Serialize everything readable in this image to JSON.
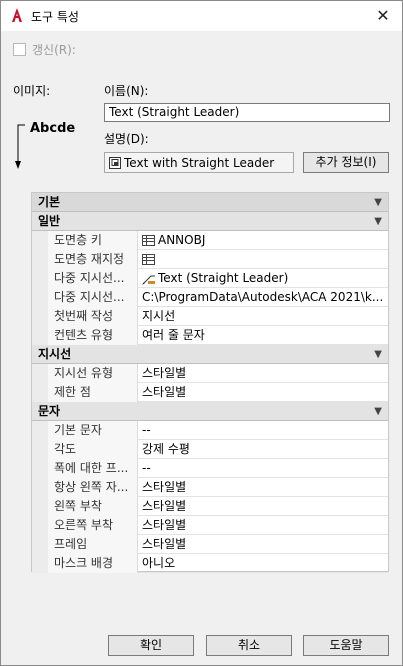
{
  "window": {
    "title": "도구 특성",
    "close_icon": "close-icon",
    "app_icon": "autocad-a-icon",
    "accent": "#c8102e"
  },
  "refresh": {
    "label": "갱신(R):",
    "checked": false
  },
  "image": {
    "label": "이미지:",
    "preview_text": "Abcde"
  },
  "name": {
    "label": "이름(N):",
    "value": "Text (Straight Leader)"
  },
  "description": {
    "label": "설명(D):",
    "value": "Text with Straight Leader"
  },
  "more_info_button": "추가 정보(I)",
  "grid": {
    "top_category": "기본",
    "sections": [
      {
        "title": "일반",
        "rows": [
          {
            "key": "도면층 키",
            "value": "ANNOBJ",
            "icon": "table-icon"
          },
          {
            "key": "도면층 재지정",
            "value": "",
            "icon": "table-icon"
          },
          {
            "key": "다중 지시선...",
            "value": "Text (Straight Leader)",
            "icon": "leader-icon"
          },
          {
            "key": "다중 지시선...",
            "value": "C:\\ProgramData\\Autodesk\\ACA  2021\\k..."
          },
          {
            "key": "첫번째 작성",
            "value": "지시선"
          },
          {
            "key": "컨텐츠 유형",
            "value": "여러 줄 문자"
          }
        ]
      },
      {
        "title": "지시선",
        "rows": [
          {
            "key": "지시선 유형",
            "value": "스타일별"
          },
          {
            "key": "제한 점",
            "value": "스타일별"
          }
        ]
      },
      {
        "title": "문자",
        "rows": [
          {
            "key": "기본 문자",
            "value": "--"
          },
          {
            "key": "각도",
            "value": "강제 수평"
          },
          {
            "key": "폭에 대한 프...",
            "value": "--"
          },
          {
            "key": "항상 왼쪽 자...",
            "value": "스타일별"
          },
          {
            "key": "왼쪽 부착",
            "value": "스타일별"
          },
          {
            "key": "오른쪽 부착",
            "value": "스타일별"
          },
          {
            "key": "프레임",
            "value": "스타일별"
          },
          {
            "key": "마스크 배경",
            "value": "아니오"
          }
        ]
      }
    ]
  },
  "buttons": {
    "ok": "확인",
    "cancel": "취소",
    "help": "도움말"
  }
}
